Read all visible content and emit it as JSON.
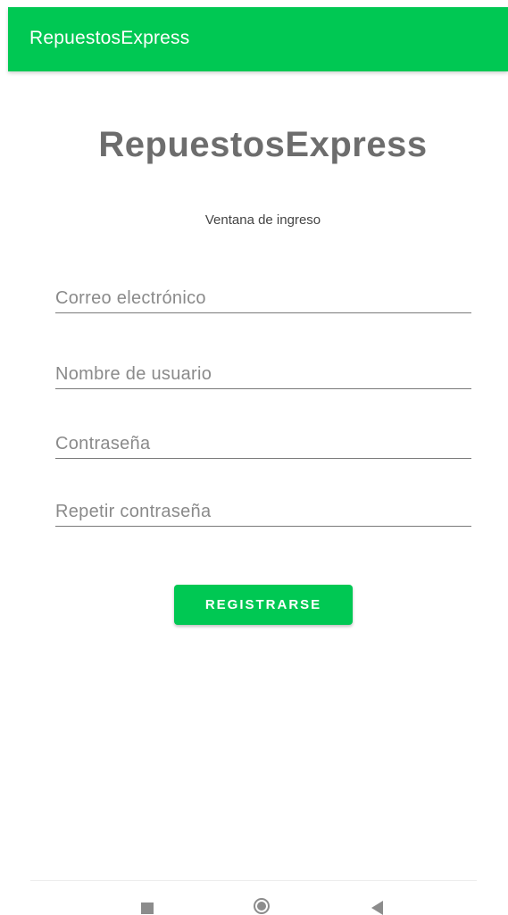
{
  "app_bar": {
    "title": "RepuestosExpress",
    "color": "#00c853"
  },
  "main": {
    "title": "RepuestosExpress",
    "subtitle": "Ventana de ingreso",
    "fields": [
      {
        "placeholder": "Correo electrónico",
        "value": ""
      },
      {
        "placeholder": "Nombre de usuario",
        "value": ""
      },
      {
        "placeholder": "Contraseña",
        "value": ""
      },
      {
        "placeholder": "Repetir contraseña",
        "value": ""
      }
    ],
    "register_button": {
      "label": "REGISTRARSE",
      "color": "#00c853"
    }
  },
  "nav_bar": {
    "icons": [
      "square-recents-icon",
      "circle-home-icon",
      "triangle-back-icon"
    ]
  }
}
